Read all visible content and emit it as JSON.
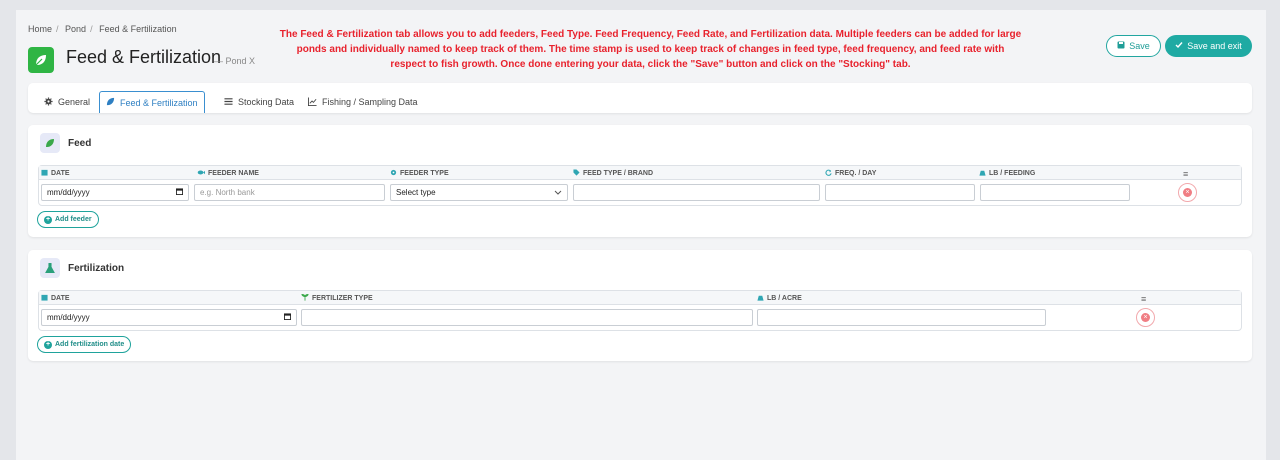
{
  "breadcrumb": [
    "Home",
    "Pond",
    "Feed & Fertilization"
  ],
  "page": {
    "title": "Feed & Fertilization",
    "subtitle": "— Pond X"
  },
  "instructions": "The Feed & Fertilization tab allows you to add feeders, Feed Type. Feed Frequency, Feed Rate, and Fertilization data. Multiple feeders can be added for large ponds and individually named to keep track of them. The time stamp is used to keep track of changes in feed type, feed frequency, and feed rate with respect to fish growth. Once done entering your data, click the \"Save\" button and click on the \"Stocking\" tab.",
  "actions": {
    "save": "Save",
    "save_exit": "Save and exit"
  },
  "tabs": [
    {
      "label": "General",
      "icon": "gear-icon"
    },
    {
      "label": "Feed & Fertilization",
      "icon": "leaf-icon",
      "active": true
    },
    {
      "label": "Stocking Data",
      "icon": "list-icon"
    },
    {
      "label": "Fishing / Sampling Data",
      "icon": "chart-icon"
    }
  ],
  "feed": {
    "title": "Feed",
    "columns": [
      "DATE",
      "FEEDER NAME",
      "FEEDER TYPE",
      "FEED TYPE / BRAND",
      "FREQ. / DAY",
      "LB / FEEDING"
    ],
    "row": {
      "date": "mm/dd/yyyy",
      "feeder_name_placeholder": "e.g. North bank",
      "feeder_type": "Select type"
    },
    "add_label": "Add feeder"
  },
  "fertilization": {
    "title": "Fertilization",
    "columns": [
      "DATE",
      "FERTILIZER TYPE",
      "LB / ACRE"
    ],
    "row": {
      "date": "mm/dd/yyyy"
    },
    "add_label": "Add fertilization date"
  },
  "colors": {
    "accent": "#1faaa3",
    "instruction_text": "#e8222d",
    "title_icon": "#2fb544",
    "active_tab": "#2e7fc2"
  }
}
